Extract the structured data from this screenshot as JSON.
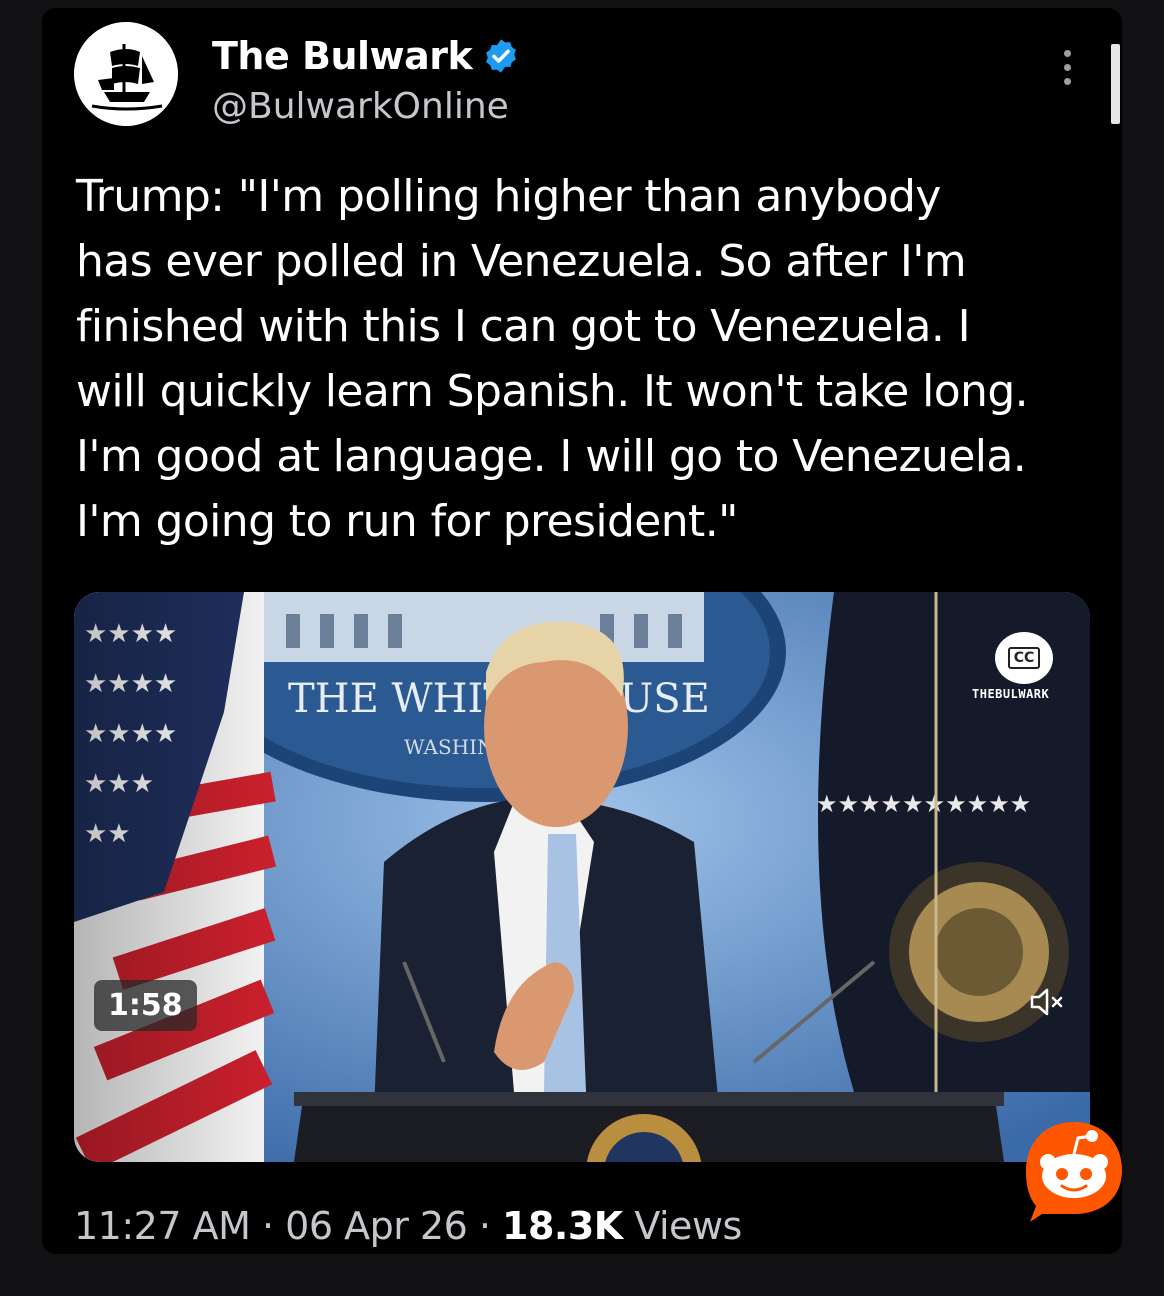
{
  "author": {
    "name": "The Bulwark",
    "handle": "@BulwarkOnline",
    "avatar_icon": "pirate-ship-icon",
    "verified_color": "#1d9bf0"
  },
  "tweet": {
    "text": "Trump: \"I'm polling higher than anybody\nhas ever polled in Venezuela. So after I'm\nfinished with this I can got to Venezuela. I\nwill quickly learn Spanish. It won't take long.\nI'm good at language. I will go to Venezuela.\nI'm going to run for president.\""
  },
  "video": {
    "duration": "1:58",
    "cc_label": "CC",
    "watermark": "THEBULWARK",
    "backdrop_text": "THE WHITE HOUSE",
    "backdrop_subtext": "WASHINGTON",
    "mute_icon": "speaker-muted-icon"
  },
  "meta": {
    "time": "11:27 AM",
    "date": "06 Apr 26",
    "separator": "·",
    "views_count": "18.3K",
    "views_label": "Views"
  },
  "colors": {
    "background": "#000000",
    "text_primary": "#ffffff",
    "text_secondary": "#c4c7cc",
    "reddit_orange": "#ff5700"
  }
}
